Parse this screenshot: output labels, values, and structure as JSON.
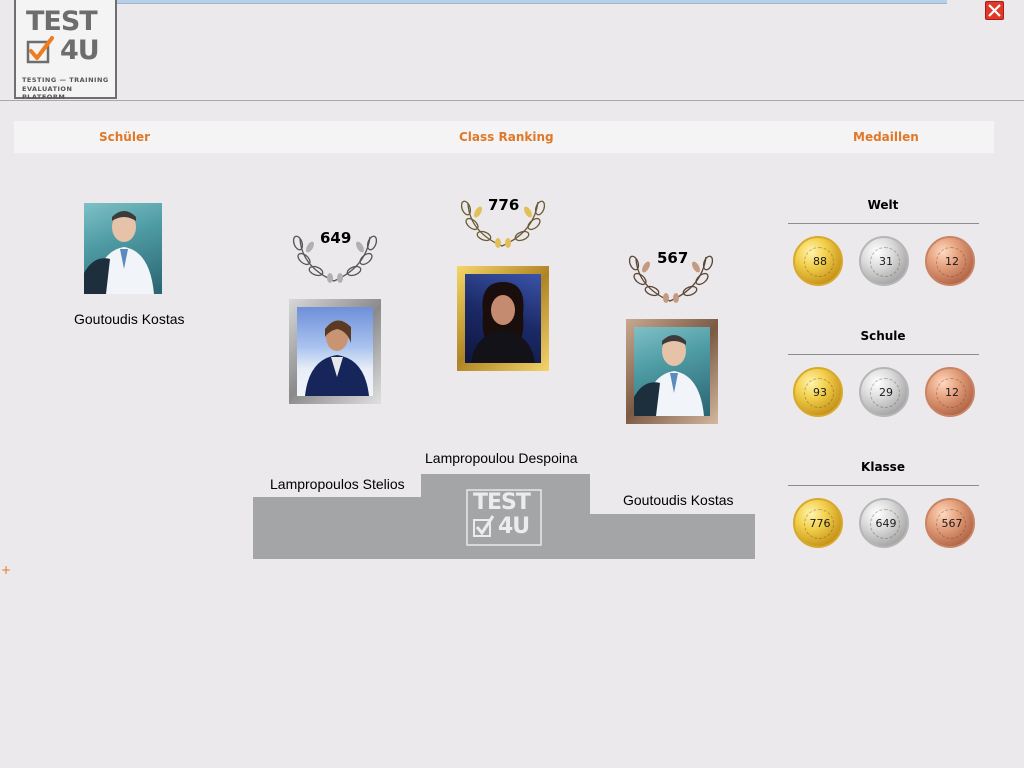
{
  "logo": {
    "line1": "TEST",
    "line2": "4U",
    "tagline1": "TESTING — TRAINING",
    "tagline2": "EVALUATION PLATFORM"
  },
  "header": {
    "students": "Schüler",
    "ranking": "Class Ranking",
    "medals": "Medaillen"
  },
  "student": {
    "name": "Goutoudis Kostas"
  },
  "ranking": {
    "first": {
      "name": "Lampropoulou Despoina",
      "score": "776"
    },
    "second": {
      "name": "Lampropoulos Stelios",
      "score": "649"
    },
    "third": {
      "name": "Goutoudis Kostas",
      "score": "567"
    }
  },
  "podium_logo": {
    "line1": "TEST",
    "line2": "4U"
  },
  "medals": {
    "world": {
      "title": "Welt",
      "gold": "88",
      "silver": "31",
      "bronze": "12"
    },
    "school": {
      "title": "Schule",
      "gold": "93",
      "silver": "29",
      "bronze": "12"
    },
    "class": {
      "title": "Klasse",
      "gold": "776",
      "silver": "649",
      "bronze": "567"
    }
  },
  "colors": {
    "accent": "#e07828",
    "background": "#ebe9ec",
    "podium": "#a3a5a6"
  },
  "icons": {
    "close": "close-icon",
    "expand": "plus-icon"
  }
}
